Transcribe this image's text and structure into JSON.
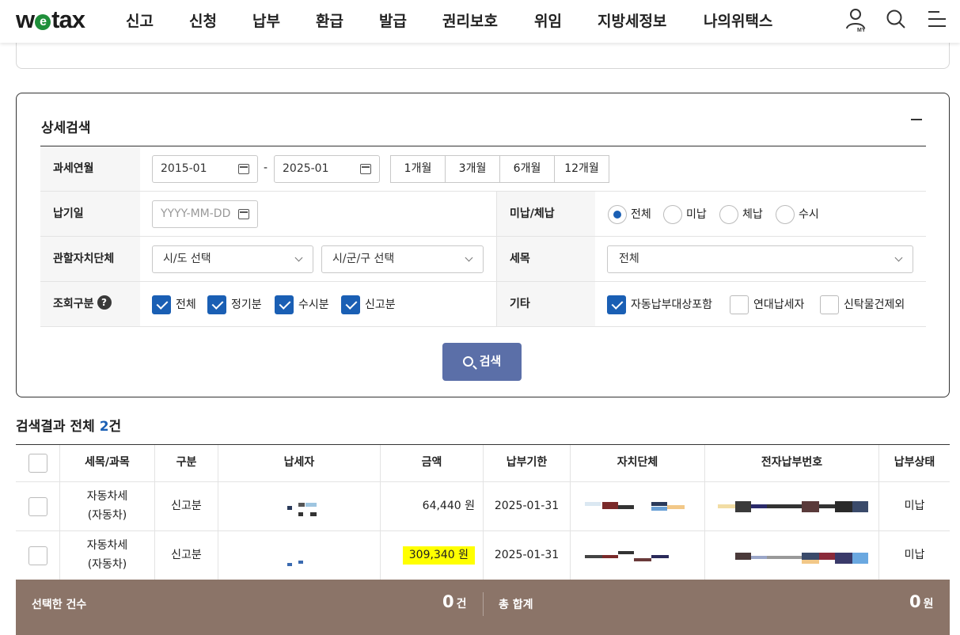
{
  "header": {
    "logo": "wetax",
    "logo_parts": {
      "pre": "w",
      "e": "e",
      "post": "tax"
    },
    "menu": [
      "신고",
      "신청",
      "납부",
      "환급",
      "발급",
      "권리보호",
      "위임",
      "지방세정보",
      "나의위택스"
    ],
    "my_badge": "MY"
  },
  "search": {
    "title": "상세검색",
    "rows": {
      "tax_period": {
        "label": "과세연월",
        "from": "2015-01",
        "sep": "-",
        "to": "2025-01",
        "periods": [
          "1개월",
          "3개월",
          "6개월",
          "12개월"
        ]
      },
      "due_date": {
        "label": "납기일",
        "placeholder": "YYYY-MM-DD"
      },
      "unpaid": {
        "label": "미납/체납",
        "options": [
          "전체",
          "미납",
          "체납",
          "수시"
        ],
        "selected": "전체"
      },
      "region": {
        "label": "관할자치단체",
        "sido": "시/도 선택",
        "sigungu": "시/군/구 선택"
      },
      "tax_item": {
        "label": "세목",
        "value": "전체"
      },
      "query_type": {
        "label": "조회구분",
        "help": "?",
        "options": [
          "전체",
          "정기분",
          "수시분",
          "신고분"
        ]
      },
      "etc": {
        "label": "기타",
        "options": [
          "자동납부대상포함",
          "연대납세자",
          "신탁물건제외"
        ]
      }
    },
    "button": "검색"
  },
  "results": {
    "prefix": "검색결과 전체 ",
    "count": "2",
    "suffix": "건",
    "columns": [
      "세목/과목",
      "구분",
      "납세자",
      "금액",
      "납부기한",
      "자치단체",
      "전자납부번호",
      "납부상태"
    ],
    "rows": [
      {
        "tax1": "자동차세",
        "tax2": "(자동차)",
        "type": "신고분",
        "amount": "64,440 원",
        "due": "2025-01-31",
        "status": "미납"
      },
      {
        "tax1": "자동차세",
        "tax2": "(자동차)",
        "type": "신고분",
        "amount": "309,340 원",
        "due": "2025-01-31",
        "status": "미납"
      }
    ]
  },
  "summary": {
    "selected_label": "선택한 건수",
    "selected_count": "0",
    "selected_unit": "건",
    "total_label": "총 합계",
    "total_amount": "0",
    "total_unit": "원"
  },
  "colors": {
    "accent": "#1a5fb4",
    "search_button": "#5b6fa8",
    "summary_bar": "#8b7468",
    "highlight": "#ffff00"
  }
}
